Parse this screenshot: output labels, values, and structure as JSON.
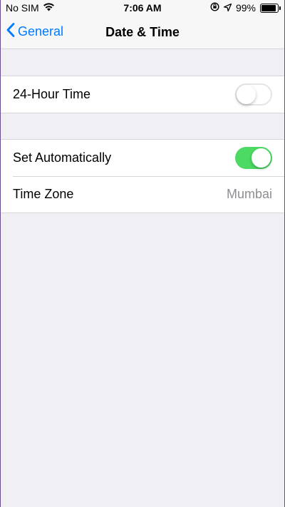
{
  "status_bar": {
    "carrier": "No SIM",
    "time": "7:06 AM",
    "battery": "99%",
    "battery_level": 0.99
  },
  "nav": {
    "back_label": "General",
    "title": "Date & Time"
  },
  "settings": {
    "hour24": {
      "label": "24-Hour Time",
      "enabled": false
    },
    "set_automatically": {
      "label": "Set Automatically",
      "enabled": true
    },
    "time_zone": {
      "label": "Time Zone",
      "value": "Mumbai"
    }
  },
  "colors": {
    "accent": "#007aff",
    "switch_on": "#4cd964",
    "background": "#efeff4"
  },
  "icons": [
    "wifi-icon",
    "orientation-lock-icon",
    "location-arrow-icon",
    "battery-icon",
    "chevron-left-icon"
  ]
}
